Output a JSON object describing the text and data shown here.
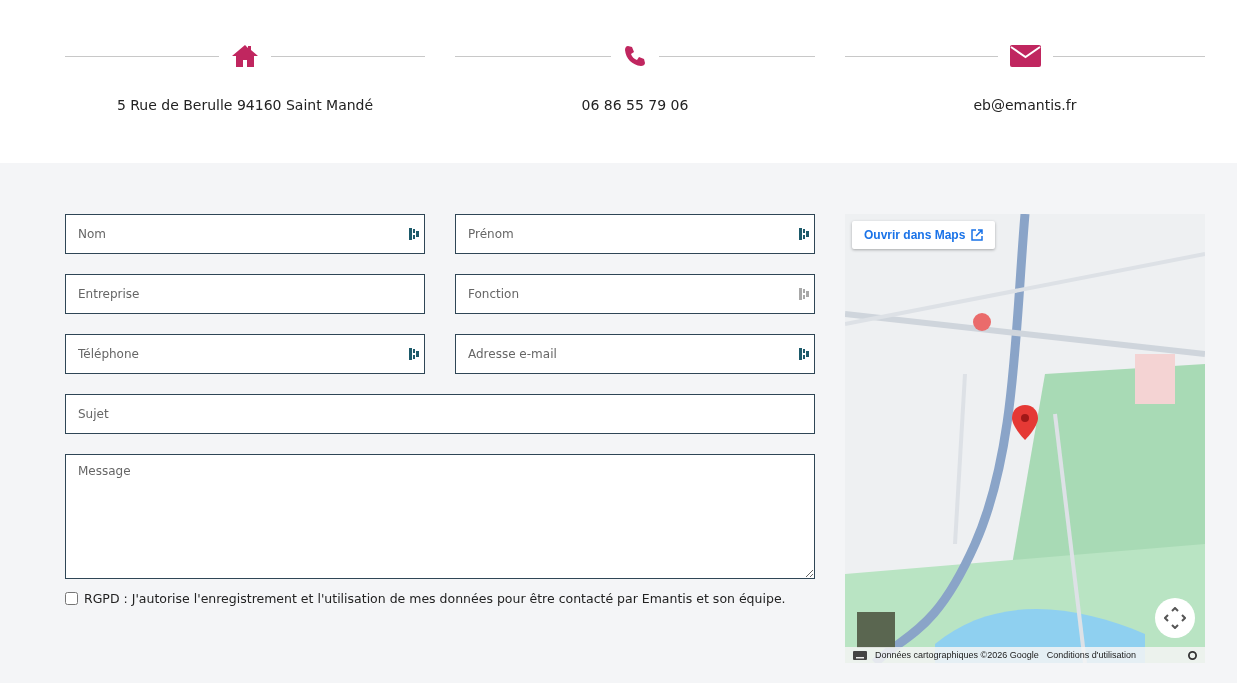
{
  "contacts": [
    {
      "kind": "home",
      "text": "5 Rue de Berulle 94160 Saint Mandé"
    },
    {
      "kind": "phone",
      "text": "06 86 55 79 06"
    },
    {
      "kind": "mail",
      "text": "eb@emantis.fr"
    }
  ],
  "form": {
    "rows": [
      [
        {
          "placeholder": "Nom",
          "autofill_active": true
        },
        {
          "placeholder": "Prénom",
          "autofill_active": true
        }
      ],
      [
        {
          "placeholder": "Entreprise"
        },
        {
          "placeholder": "Fonction",
          "autofill_active": false
        }
      ],
      [
        {
          "placeholder": "Téléphone",
          "autofill_active": true
        },
        {
          "placeholder": "Adresse e-mail",
          "autofill_active": true
        }
      ],
      [
        {
          "placeholder": "Sujet"
        }
      ]
    ],
    "message": {
      "placeholder": "Message"
    },
    "consent": {
      "label": "RGPD : J'autorise l'enregistrement et l'utilisation de mes données pour être contacté par Emantis et son équipe.",
      "checked": false
    }
  },
  "map": {
    "kind": "picture",
    "open_button": "Ouvrir dans Maps",
    "attribution": "Données cartographiques ©2026 Google",
    "terms": "Conditions d'utilisation"
  }
}
